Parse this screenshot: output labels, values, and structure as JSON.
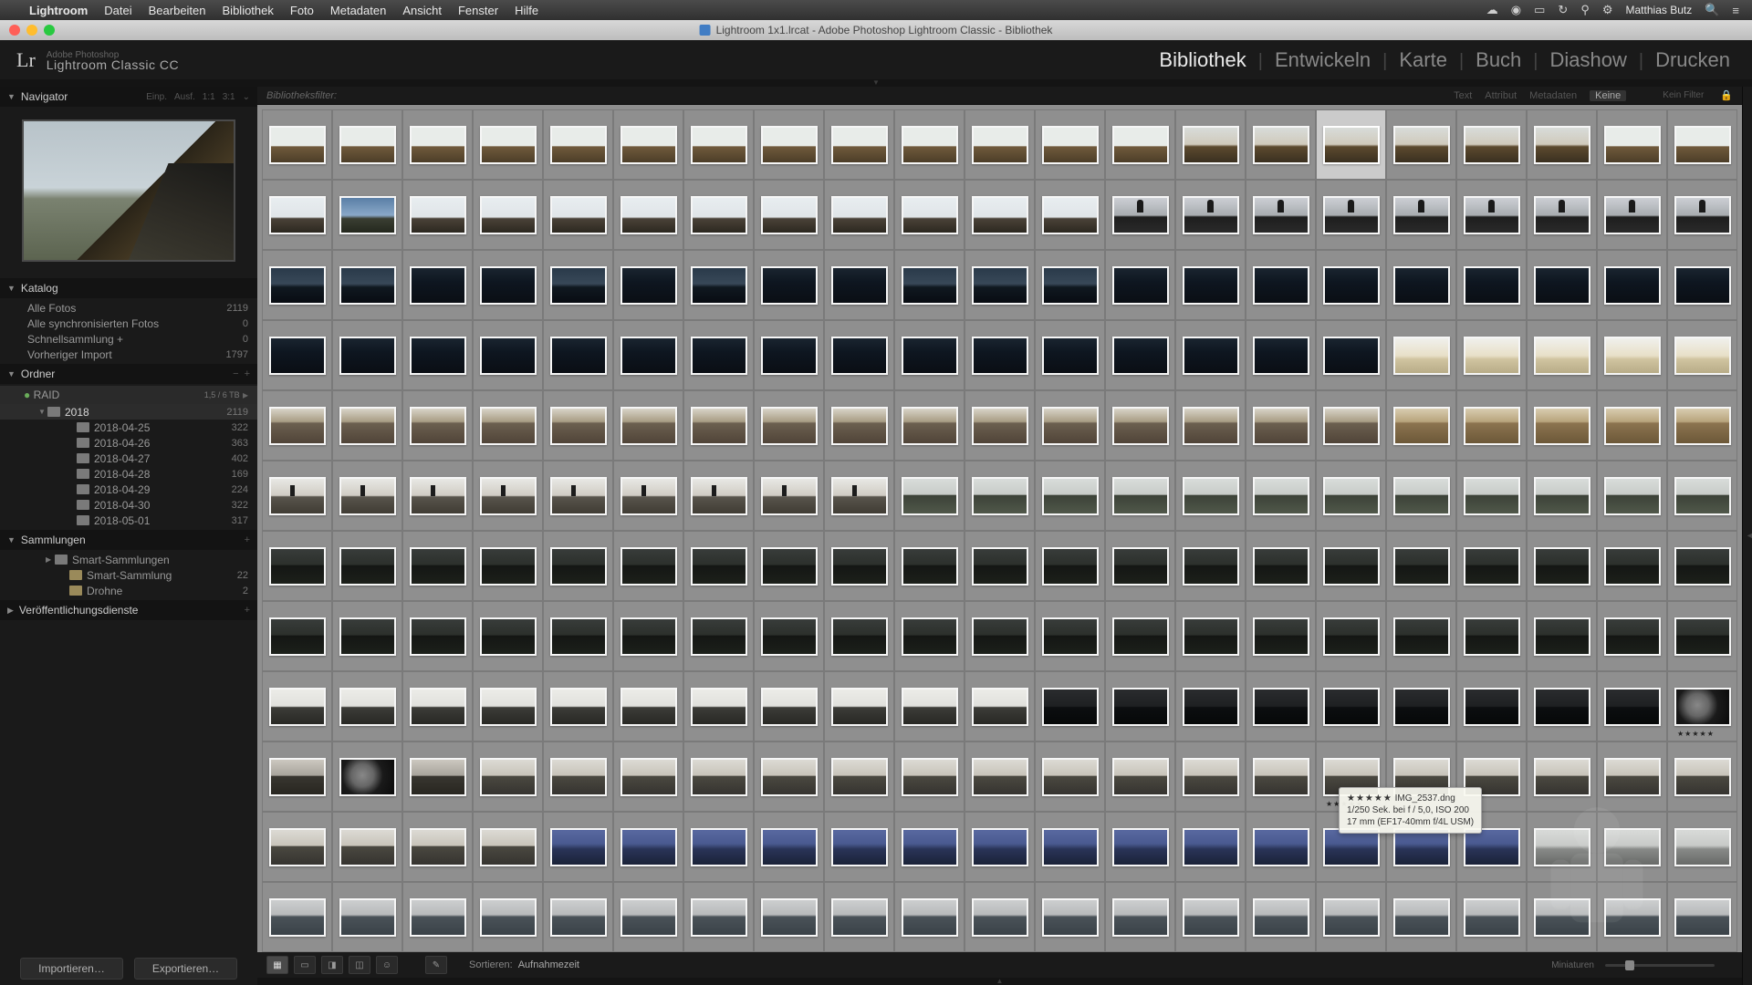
{
  "menubar": {
    "items": [
      "Lightroom",
      "Datei",
      "Bearbeiten",
      "Bibliothek",
      "Foto",
      "Metadaten",
      "Ansicht",
      "Fenster",
      "Hilfe"
    ],
    "user": "Matthias Butz",
    "search_icon": "⌕"
  },
  "window": {
    "title": "Lightroom 1x1.lrcat - Adobe Photoshop Lightroom Classic - Bibliothek"
  },
  "header": {
    "brand_top": "Adobe Photoshop",
    "brand_main": "Lightroom Classic CC",
    "logo": "Lr",
    "modules": [
      "Bibliothek",
      "Entwickeln",
      "Karte",
      "Buch",
      "Diashow",
      "Drucken"
    ],
    "active_module": 0
  },
  "navigator": {
    "title": "Navigator",
    "fit": "Einp.",
    "fill": "Ausf.",
    "r1": "1:1",
    "r2": "3:1"
  },
  "katalog": {
    "title": "Katalog",
    "rows": [
      {
        "label": "Alle Fotos",
        "count": "2119"
      },
      {
        "label": "Alle synchronisierten Fotos",
        "count": "0"
      },
      {
        "label": "Schnellsammlung  +",
        "count": "0"
      },
      {
        "label": "Vorheriger Import",
        "count": "1797"
      }
    ]
  },
  "ordner": {
    "title": "Ordner",
    "volume": {
      "name": "RAID",
      "free": "1,5 / 6 TB"
    },
    "year": {
      "name": "2018",
      "count": "2119"
    },
    "dates": [
      {
        "name": "2018-04-25",
        "count": "322"
      },
      {
        "name": "2018-04-26",
        "count": "363"
      },
      {
        "name": "2018-04-27",
        "count": "402"
      },
      {
        "name": "2018-04-28",
        "count": "169"
      },
      {
        "name": "2018-04-29",
        "count": "224"
      },
      {
        "name": "2018-04-30",
        "count": "322"
      },
      {
        "name": "2018-05-01",
        "count": "317"
      }
    ]
  },
  "sammlungen": {
    "title": "Sammlungen",
    "rows": [
      {
        "name": "Smart-Sammlungen",
        "count": ""
      },
      {
        "name": "Smart-Sammlung",
        "count": "22"
      },
      {
        "name": "Drohne",
        "count": "2"
      }
    ]
  },
  "publish": {
    "title": "Veröffentlichungsdienste"
  },
  "buttons": {
    "import": "Importieren…",
    "export": "Exportieren…"
  },
  "filter": {
    "label": "Bibliotheksfilter:",
    "tabs": [
      "Text",
      "Attribut",
      "Metadaten"
    ],
    "none": "Keine",
    "custom": "Kein Filter"
  },
  "toolbar": {
    "sort_lbl": "Sortieren:",
    "sort_val": "Aufnahmezeit",
    "thumb_lbl": "Miniaturen"
  },
  "tooltip": {
    "file": "IMG_2537.dng",
    "line2": "1/250 Sek. bei f / 5,0, ISO 200",
    "line3": "17 mm (EF17-40mm f/4L USM)",
    "stars": "★★★★★"
  },
  "grid": {
    "selected": [
      [
        0,
        15
      ]
    ],
    "rated": [
      [
        8,
        20
      ]
    ],
    "hover": [
      9,
      15
    ],
    "rows": [
      [
        "hills",
        "hills",
        "hills",
        "hills",
        "hills",
        "hills",
        "hills",
        "hills",
        "hills",
        "hills",
        "hills",
        "hills",
        "hills",
        "hillsd",
        "hillsd",
        "hillsd",
        "hillsd",
        "hillsd",
        "hillsd",
        "hills",
        "hills"
      ],
      [
        "sky",
        "skyblue",
        "sky",
        "sky",
        "sky",
        "sky",
        "sky",
        "sky",
        "sky",
        "sky",
        "sky",
        "sky",
        "person",
        "person",
        "person",
        "person",
        "person",
        "person",
        "person",
        "person",
        "person"
      ],
      [
        "darksea2",
        "darksea2",
        "darksea",
        "darksea",
        "darksea2",
        "darksea",
        "darksea2",
        "darksea",
        "darksea",
        "darksea2",
        "darksea2",
        "darksea2",
        "darksea",
        "darksea",
        "darksea",
        "darksea",
        "darksea",
        "darksea",
        "darksea",
        "darksea",
        "darksea"
      ],
      [
        "darksea",
        "darksea",
        "darksea",
        "darksea",
        "darksea",
        "darksea",
        "darksea",
        "darksea",
        "darksea",
        "darksea",
        "darksea",
        "darksea",
        "darksea",
        "darksea",
        "darksea",
        "darksea",
        "cream",
        "cream",
        "cream",
        "cream",
        "cream"
      ],
      [
        "rocks",
        "rocks",
        "rocks",
        "rocks",
        "rocks",
        "rocks",
        "rocks",
        "rocks",
        "rocks",
        "rocks",
        "rocks",
        "rocks",
        "rocks",
        "rocks",
        "rocks",
        "rocks",
        "rockswarm",
        "rockswarm",
        "rockswarm",
        "rockswarm",
        "rockswarm"
      ],
      [
        "walker",
        "walker",
        "walker",
        "walker",
        "walker",
        "walker",
        "walker",
        "walker",
        "walker",
        "river",
        "river",
        "river",
        "river",
        "river",
        "river",
        "river",
        "river",
        "river",
        "river",
        "river",
        "river"
      ],
      [
        "riverd",
        "riverd",
        "riverd",
        "riverd",
        "riverd",
        "riverd",
        "riverd",
        "riverd",
        "riverd",
        "riverd",
        "riverd",
        "riverd",
        "riverd",
        "riverd",
        "riverd",
        "riverd",
        "riverd",
        "riverd",
        "riverd",
        "riverd",
        "riverd"
      ],
      [
        "riverd",
        "riverd",
        "riverd",
        "riverd",
        "riverd",
        "riverd",
        "riverd",
        "riverd",
        "riverd",
        "riverd",
        "riverd",
        "riverd",
        "riverd",
        "riverd",
        "riverd",
        "riverd",
        "riverd",
        "riverd",
        "riverd",
        "riverd",
        "riverd"
      ],
      [
        "stream",
        "stream",
        "stream",
        "stream",
        "stream",
        "stream",
        "stream",
        "stream",
        "stream",
        "stream",
        "stream",
        "streamd",
        "streamd",
        "streamd",
        "streamd",
        "streamd",
        "streamd",
        "streamd",
        "streamd",
        "streamd",
        "closeup"
      ],
      [
        "valleybw",
        "closeup",
        "valleybw",
        "valley",
        "valley",
        "valley",
        "valley",
        "valley",
        "valley",
        "valley",
        "valley",
        "valley",
        "valley",
        "valley",
        "valley",
        "valley",
        "valley",
        "valley",
        "valley",
        "valley",
        "valley"
      ],
      [
        "valley",
        "valley",
        "valley",
        "valley",
        "bluesea",
        "bluesea",
        "bluesea",
        "bluesea",
        "bluesea",
        "bluesea",
        "bluesea",
        "bluesea",
        "bluesea",
        "bluesea",
        "bluesea",
        "bluesea",
        "bluesea",
        "bluesea",
        "fog",
        "fog",
        "fog"
      ],
      [
        "loch",
        "loch",
        "loch",
        "loch",
        "loch",
        "loch",
        "loch",
        "loch",
        "loch",
        "loch",
        "loch",
        "loch",
        "loch",
        "loch",
        "loch",
        "loch",
        "loch",
        "loch",
        "loch",
        "loch",
        "loch"
      ]
    ]
  }
}
